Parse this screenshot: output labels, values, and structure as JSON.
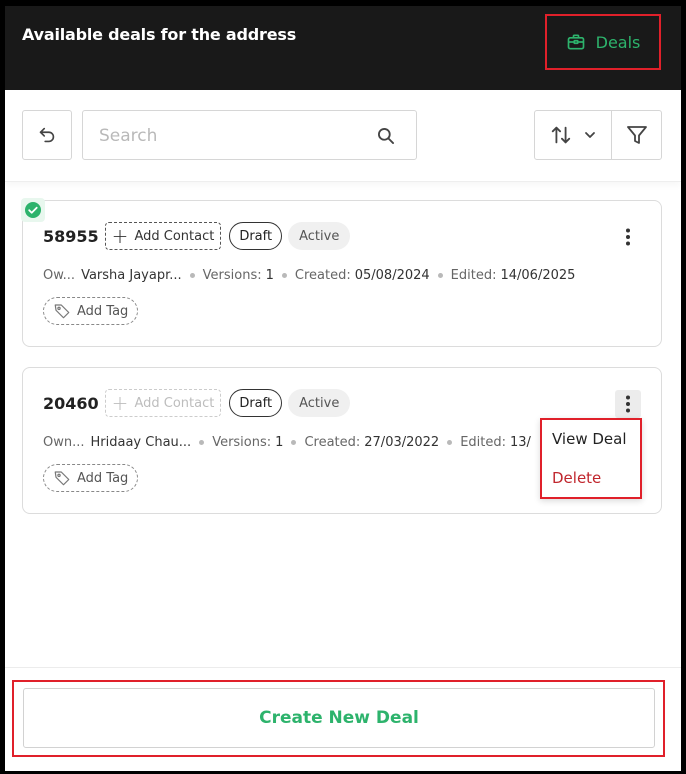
{
  "header": {
    "title": "Available deals for the address",
    "deals_label": "Deals"
  },
  "toolbar": {
    "search_placeholder": "Search"
  },
  "deals": [
    {
      "id": "58955",
      "selected": true,
      "add_contact_label": "Add Contact",
      "status": "Draft",
      "state": "Active",
      "owner_label": "Ow...",
      "owner": "Varsha Jayapr...",
      "versions_label": "Versions:",
      "versions": "1",
      "created_label": "Created:",
      "created": "05/08/2024",
      "edited_label": "Edited:",
      "edited": "14/06/2025",
      "tag_label": "Add Tag"
    },
    {
      "id": "20460",
      "selected": false,
      "add_contact_label": "Add Contact",
      "status": "Draft",
      "state": "Active",
      "owner_label": "Own...",
      "owner": "Hridaay Chau...",
      "versions_label": "Versions:",
      "versions": "1",
      "created_label": "Created:",
      "created": "27/03/2022",
      "edited_label": "Edited:",
      "edited": "13/",
      "tag_label": "Add Tag"
    }
  ],
  "context_menu": {
    "view": "View Deal",
    "delete": "Delete"
  },
  "footer": {
    "create_label": "Create New Deal"
  },
  "colors": {
    "accent_green": "#2db36c",
    "header_bg": "#191919",
    "highlight_red": "#e0202a",
    "delete_red": "#c0262d"
  }
}
